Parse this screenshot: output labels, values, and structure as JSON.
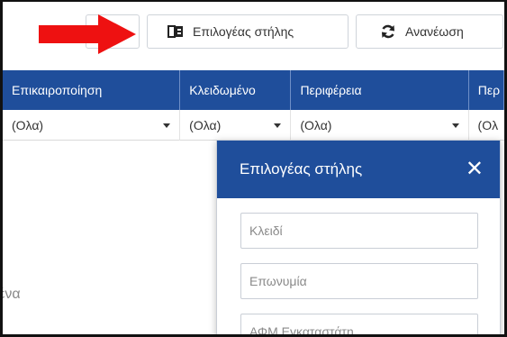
{
  "toolbar": {
    "column_chooser_label": "Επιλογέας στήλης",
    "refresh_label": "Ανανέωση",
    "arrow_color": "#ee1111"
  },
  "grid": {
    "columns": [
      "Επικαιροποίηση",
      "Κλειδωμένο",
      "Περιφέρεια",
      "Περ"
    ],
    "filters": [
      "(Ολα)",
      "(Ολα)",
      "(Ολα)",
      "(Ολ"
    ],
    "empty_text_fragment": "μένα"
  },
  "popup": {
    "title": "Επιλογέας στήλης",
    "fields": [
      "Κλειδί",
      "Επωνυμία",
      "ΑΦΜ Εγκαταστάτη"
    ]
  },
  "colors": {
    "header_bg": "#1f4e9b",
    "border": "#cfd4da"
  }
}
